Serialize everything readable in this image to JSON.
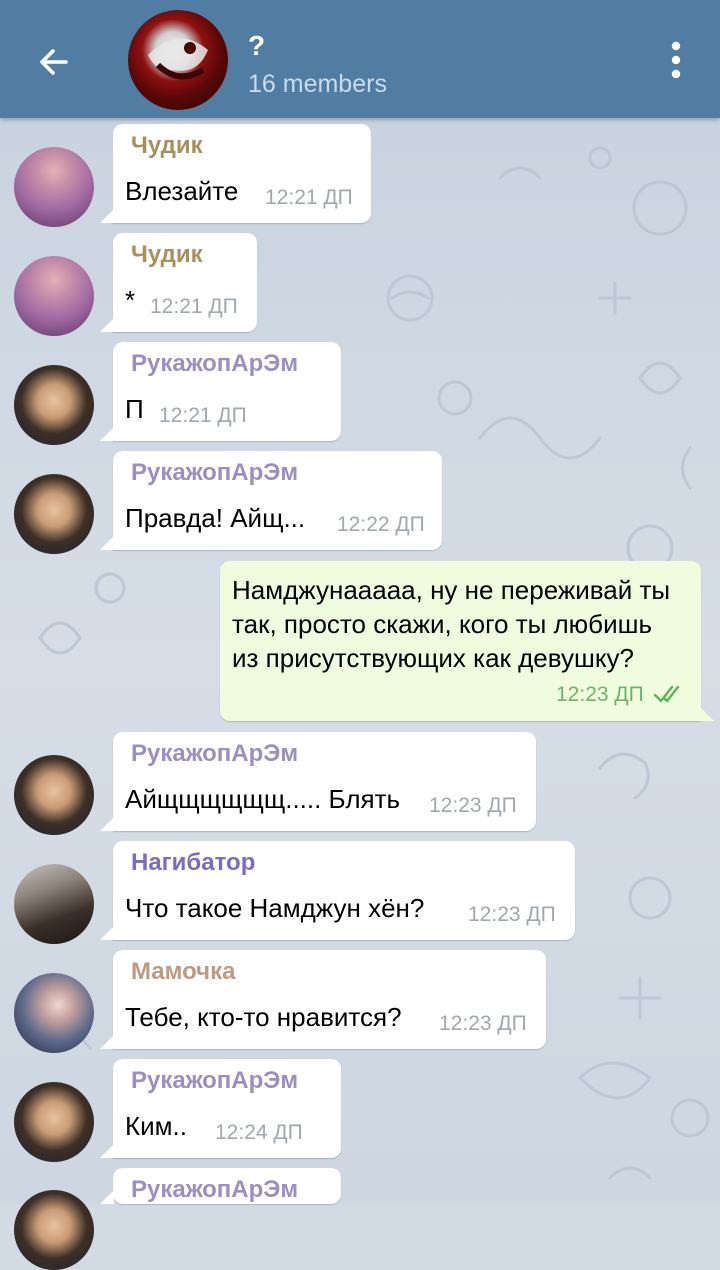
{
  "header": {
    "back_icon": "arrow-left-icon",
    "title": "?",
    "subtitle": "16 members",
    "menu_icon": "more-vertical-icon",
    "bg_color": "#527da3"
  },
  "messages": [
    {
      "sender": "Чудик",
      "sender_color": "#a6905d",
      "text": "Влезайте",
      "time": "12:21 ДП"
    },
    {
      "sender": "Чудик",
      "sender_color": "#a6905d",
      "text": "*",
      "time": "12:21 ДП"
    },
    {
      "sender": "РукажопАрЭм",
      "sender_color": "#9b8fc0",
      "text": "П",
      "time": "12:21 ДП"
    },
    {
      "sender": "РукажопАрЭм",
      "sender_color": "#9b8fc0",
      "text": "Правда! Айщ...",
      "time": "12:22 ДП"
    },
    {
      "outgoing": true,
      "text": "Намджунааааа, ну не переживай ты так, просто скажи, кого ты любишь из присутствующих как девушку?",
      "time": "12:23 ДП",
      "status": "read"
    },
    {
      "sender": "РукажопАрЭм",
      "sender_color": "#9b8fc0",
      "text": "Айщщщщщщ..... Блять",
      "time": "12:23 ДП"
    },
    {
      "sender": "Нагибатор",
      "sender_color": "#7c6bbf",
      "text": "Что такое Намджун хён?",
      "time": "12:23 ДП"
    },
    {
      "sender": "Мамочка",
      "sender_color": "#c09a80",
      "text": "Тебе, кто-то нравится?",
      "time": "12:23 ДП"
    },
    {
      "sender": "РукажопАрЭм",
      "sender_color": "#9b8fc0",
      "text": "Ким..",
      "time": "12:24 ДП"
    },
    {
      "sender": "РукажопАрЭм",
      "sender_color": "#9b8fc0",
      "text": "",
      "time": ""
    }
  ]
}
